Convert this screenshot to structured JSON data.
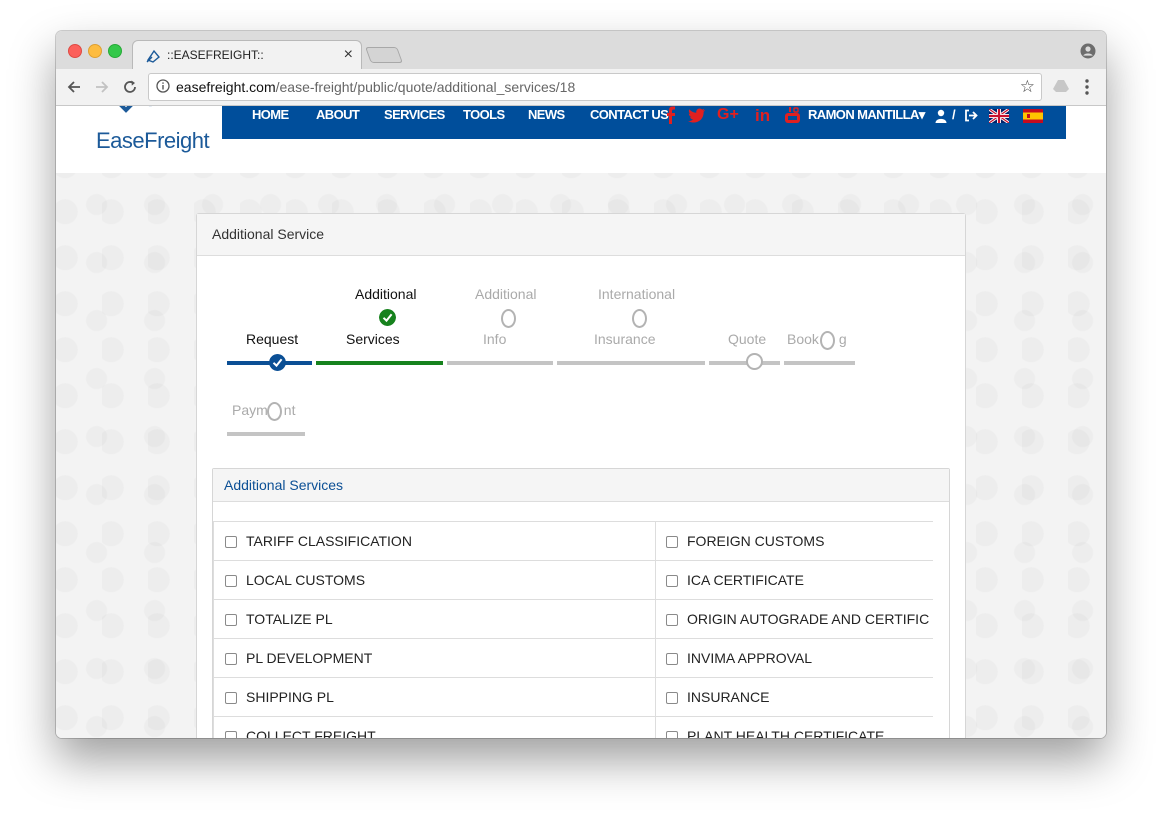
{
  "browser": {
    "tab_title": "::EASEFREIGHT::",
    "tab_close": "×",
    "url_host": "easefreight.com",
    "url_path": "/ease-freight/public/quote/additional_services/18",
    "bookmark_star": "☆"
  },
  "site": {
    "logo_text": "EaseFreight",
    "nav": [
      "HOME",
      "ABOUT",
      "SERVICES",
      "TOOLS",
      "NEWS",
      "CONTACT US"
    ],
    "social": [
      "f",
      "t",
      "G+",
      "in",
      "yt"
    ],
    "user_name": "RAMON MANTILLA",
    "user_caret": "▾",
    "separator": "/",
    "accent_color": "#004e9b",
    "social_color": "#e02020"
  },
  "panel": {
    "title": "Additional Service"
  },
  "steps": [
    {
      "label_top": "",
      "label_bottom": "Request",
      "status": "done"
    },
    {
      "label_top": "Additional",
      "label_bottom": "Services",
      "status": "current"
    },
    {
      "label_top": "Additional",
      "label_bottom": "Info",
      "status": "pending"
    },
    {
      "label_top": "International",
      "label_bottom": "Insurance",
      "status": "pending"
    },
    {
      "label_top": "",
      "label_bottom": "Quote",
      "status": "pending"
    },
    {
      "label_top": "",
      "label_bottom": "Book",
      "status": "pending",
      "clipped_suffix": "g"
    },
    {
      "label_top": "",
      "label_bottom": "Paym",
      "status": "pending",
      "clipped_suffix": "nt"
    }
  ],
  "services": {
    "title": "Additional Services",
    "rows": [
      {
        "left": "TARIFF CLASSIFICATION",
        "right": "FOREIGN CUSTOMS"
      },
      {
        "left": "LOCAL CUSTOMS",
        "right": "ICA CERTIFICATE"
      },
      {
        "left": "TOTALIZE PL",
        "right": "ORIGIN AUTOGRADE AND CERTIFIC"
      },
      {
        "left": "PL DEVELOPMENT",
        "right": "INVIMA APPROVAL"
      },
      {
        "left": "SHIPPING PL",
        "right": "INSURANCE"
      },
      {
        "left": "COLLECT FREIGHT",
        "right": "PLANT HEALTH CERTIFICATE"
      }
    ]
  }
}
